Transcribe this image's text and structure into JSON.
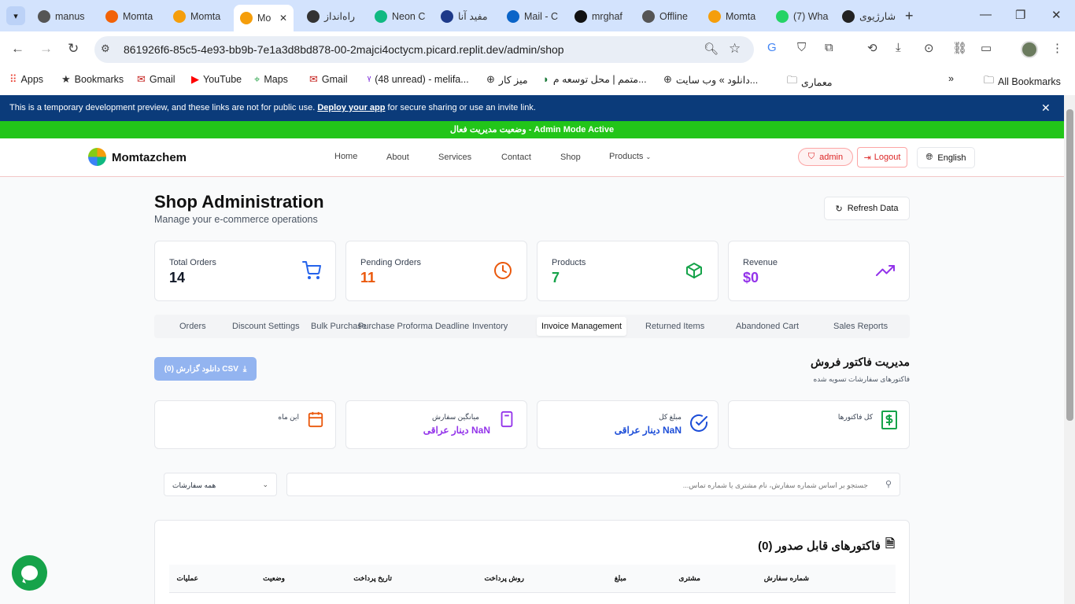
{
  "browser": {
    "tabs": [
      {
        "title": "manus",
        "icon": "manus-icon",
        "color": "#555555"
      },
      {
        "title": "Momta",
        "icon": "replit-icon",
        "color": "#f26207"
      },
      {
        "title": "Momta",
        "icon": "momtazchem-icon",
        "color": "#f59e0b"
      },
      {
        "title": "Mo",
        "icon": "momtazchem-icon",
        "color": "#f59e0b"
      },
      {
        "title": "راه‌انداز",
        "icon": "openai-icon",
        "color": "#333333"
      },
      {
        "title": "Neon C",
        "icon": "neon-icon",
        "color": "#10b981"
      },
      {
        "title": "مفید آنا",
        "icon": "mofid-icon",
        "color": "#1e3a8a"
      },
      {
        "title": "Mail - C",
        "icon": "outlook-icon",
        "color": "#0a64c8"
      },
      {
        "title": "mrghaf",
        "icon": "github-icon",
        "color": "#111111"
      },
      {
        "title": "Offline",
        "icon": "globe-icon",
        "color": "#555555"
      },
      {
        "title": "Momta",
        "icon": "momtazchem-icon",
        "color": "#f59e0b"
      },
      {
        "title": "(7) Wha",
        "icon": "whatsapp-icon",
        "color": "#25d366"
      },
      {
        "title": "شارژیوی",
        "icon": "sharjiv-icon",
        "color": "#222222"
      }
    ],
    "url": "861926f6-85c5-4e93-bb9b-7e1a3d8bd878-00-2majci4octycm.picard.replit.dev/admin/shop",
    "bookmarks": [
      {
        "label": "Apps",
        "icon": "apps-grid-icon"
      },
      {
        "label": "Bookmarks",
        "icon": "star-icon"
      },
      {
        "label": "Gmail",
        "icon": "gmail-icon"
      },
      {
        "label": "YouTube",
        "icon": "youtube-icon"
      },
      {
        "label": "Maps",
        "icon": "maps-icon"
      },
      {
        "label": "Gmail",
        "icon": "gmail-icon"
      },
      {
        "label": "(48 unread) - melifa...",
        "icon": "yahoo-icon"
      },
      {
        "label": "میز کار",
        "icon": "globe-icon"
      },
      {
        "label": "متمم | محل توسعه م...",
        "icon": "motamem-icon"
      },
      {
        "label": "دانلود » وب سایت...",
        "icon": "globe-icon"
      },
      {
        "label": "معماری",
        "icon": "folder-icon"
      }
    ],
    "all_bookmarks": "All Bookmarks"
  },
  "dev_banner": {
    "text_before": "This is a temporary development preview, and these links are not for public use. ",
    "link": "Deploy your app",
    "text_after": " for secure sharing or use an invite link."
  },
  "admin_bar": "وضعیت مدیریت فعال - Admin Mode Active",
  "site": {
    "brand": "Momtazchem",
    "nav": [
      "Home",
      "About",
      "Services",
      "Contact",
      "Shop",
      "Products"
    ],
    "admin_label": "admin",
    "logout_label": "Logout",
    "language": "English"
  },
  "page": {
    "title": "Shop Administration",
    "subtitle": "Manage your e-commerce operations",
    "refresh": "Refresh Data"
  },
  "stats": [
    {
      "label": "Total Orders",
      "value": "14",
      "color": "#111827",
      "icon": "cart-icon"
    },
    {
      "label": "Pending Orders",
      "value": "11",
      "color": "#ea580c",
      "icon": "clock-icon"
    },
    {
      "label": "Products",
      "value": "7",
      "color": "#16a34a",
      "icon": "box-icon"
    },
    {
      "label": "Revenue",
      "value": "$0",
      "color": "#9333ea",
      "icon": "trending-up-icon"
    }
  ],
  "admin_tabs": [
    "Orders",
    "Discount Settings",
    "Bulk Purchase",
    "Purchase Proforma Deadline",
    "Inventory",
    "Invoice Management",
    "Returned Items",
    "Abandoned Cart",
    "Sales Reports"
  ],
  "active_tab": "Invoice Management",
  "invoice": {
    "csv_button": "دانلود گزارش (0) CSV",
    "title": "مدیریت فاکتور فروش",
    "subtitle": "فاکتورهای سفارشات تسویه شده",
    "cards": [
      {
        "label": "این ماه",
        "value": "",
        "icon": "calendar-icon",
        "color": "#ea580c"
      },
      {
        "label": "میانگین سفارش",
        "value": "NaN دینار عراقی",
        "icon": "calculator-icon",
        "color": "#9333ea"
      },
      {
        "label": "مبلغ کل",
        "value": "NaN دینار عراقی",
        "icon": "check-circle-icon",
        "color": "#1d4ed8"
      },
      {
        "label": "کل فاکتورها",
        "value": "",
        "icon": "dollar-file-icon",
        "color": "#16a34a"
      }
    ],
    "filter_value": "همه سفارشات",
    "search_placeholder": "جستجو بر اساس شماره سفارش، نام مشتری یا شماره تماس...",
    "table_title": "فاکتورهای قابل صدور (0)",
    "columns": [
      "شماره سفارش",
      "مشتری",
      "مبلغ",
      "روش پرداخت",
      "تاریخ پرداخت",
      "وضعیت",
      "عملیات"
    ]
  }
}
